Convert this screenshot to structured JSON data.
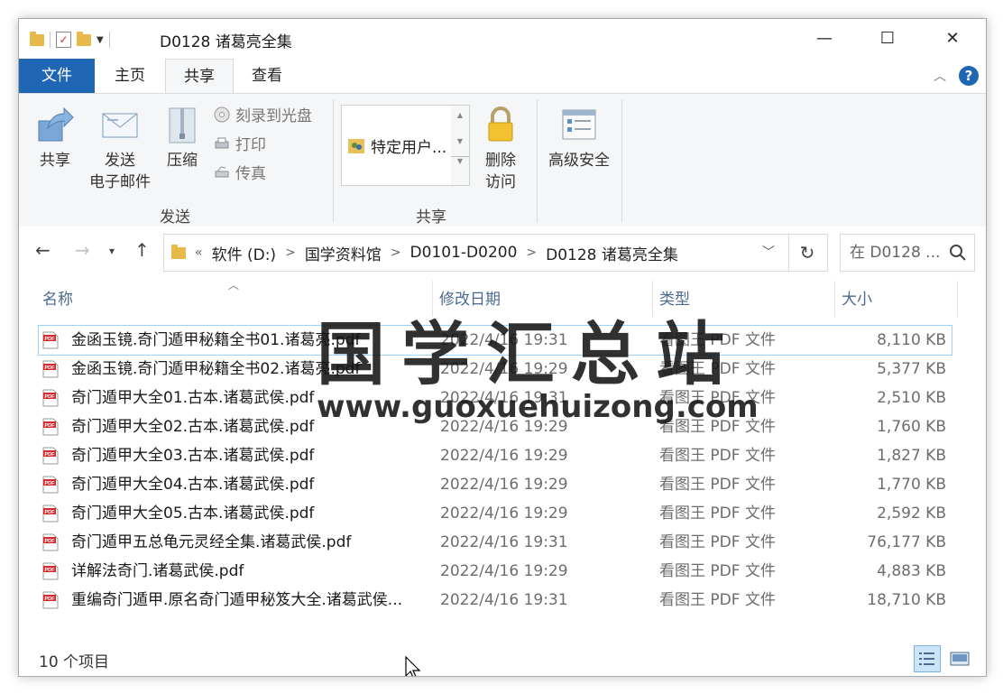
{
  "window": {
    "title": "D0128 诸葛亮全集",
    "controls": [
      "—",
      "☐",
      "✕"
    ]
  },
  "ribbon": {
    "tabs": [
      "文件",
      "主页",
      "共享",
      "查看"
    ],
    "active_tab": "共享",
    "send_group": {
      "label": "发送",
      "share": "共享",
      "email_line1": "发送",
      "email_line2": "电子邮件",
      "zip": "压缩",
      "burn": "刻录到光盘",
      "print": "打印",
      "fax": "传真"
    },
    "share_group": {
      "label": "共享",
      "share_with": "特定用户...",
      "stop_line1": "删除",
      "stop_line2": "访问"
    },
    "advanced_security": "高级安全"
  },
  "address": {
    "overflow": "«",
    "crumbs": [
      "软件 (D:)",
      "国学资料馆",
      "D0101-D0200",
      "D0128 诸葛亮全集"
    ],
    "search_placeholder": "在 D0128 ..."
  },
  "columns": {
    "name": "名称",
    "date": "修改日期",
    "type": "类型",
    "size": "大小"
  },
  "files": [
    {
      "name": "金函玉镜.奇门遁甲秘籍全书01.诸葛亮.pdf",
      "date": "2022/4/16 19:31",
      "type": "看图王 PDF 文件",
      "size": "8,110 KB"
    },
    {
      "name": "金函玉镜.奇门遁甲秘籍全书02.诸葛亮.pdf",
      "date": "2022/4/16 19:29",
      "type": "看图王 PDF 文件",
      "size": "5,377 KB"
    },
    {
      "name": "奇门遁甲大全01.古本.诸葛武侯.pdf",
      "date": "2022/4/16 19:31",
      "type": "看图王 PDF 文件",
      "size": "2,510 KB"
    },
    {
      "name": "奇门遁甲大全02.古本.诸葛武侯.pdf",
      "date": "2022/4/16 19:29",
      "type": "看图王 PDF 文件",
      "size": "1,760 KB"
    },
    {
      "name": "奇门遁甲大全03.古本.诸葛武侯.pdf",
      "date": "2022/4/16 19:29",
      "type": "看图王 PDF 文件",
      "size": "1,827 KB"
    },
    {
      "name": "奇门遁甲大全04.古本.诸葛武侯.pdf",
      "date": "2022/4/16 19:29",
      "type": "看图王 PDF 文件",
      "size": "1,770 KB"
    },
    {
      "name": "奇门遁甲大全05.古本.诸葛武侯.pdf",
      "date": "2022/4/16 19:29",
      "type": "看图王 PDF 文件",
      "size": "2,592 KB"
    },
    {
      "name": "奇门遁甲五总龟元灵经全集.诸葛武侯.pdf",
      "date": "2022/4/16 19:31",
      "type": "看图王 PDF 文件",
      "size": "76,177 KB"
    },
    {
      "name": "详解法奇门.诸葛武侯.pdf",
      "date": "2022/4/16 19:29",
      "type": "看图王 PDF 文件",
      "size": "4,883 KB"
    },
    {
      "name": "重编奇门遁甲.原名奇门遁甲秘笈大全.诸葛武侯...",
      "date": "2022/4/16 19:31",
      "type": "看图王 PDF 文件",
      "size": "18,710 KB"
    }
  ],
  "status": {
    "count": "10 个项目"
  },
  "watermark": {
    "title": "国学汇总站",
    "url": "www.guoxuehuizong.com"
  },
  "colors": {
    "file_tab": "#1f66b5",
    "selection_outline": "#99d1ff",
    "header_text": "#4a6a90"
  }
}
